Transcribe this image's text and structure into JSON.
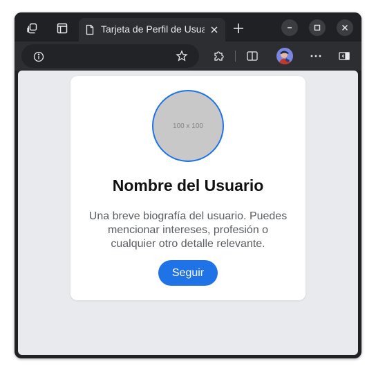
{
  "browser": {
    "tab": {
      "title": "Tarjeta de Perfil de Usuario"
    },
    "icons": {
      "workspaces": "workspaces-icon",
      "tab_actions": "tab-actions-icon",
      "page": "page-icon",
      "close": "close-icon",
      "new_tab": "plus-icon",
      "minimize": "minimize-icon",
      "maximize": "maximize-icon",
      "window_close": "close-icon",
      "site_info": "info-icon",
      "favorite": "star-icon",
      "extensions": "puzzle-icon",
      "split_screen": "split-screen-icon",
      "profile": "avatar",
      "more": "ellipsis-icon",
      "sidebar": "sidebar-icon"
    }
  },
  "profile_card": {
    "avatar_placeholder": "100 x 100",
    "name": "Nombre del Usuario",
    "bio": "Una breve biografía del usuario. Puedes mencionar intereses, profesión o cualquier otro detalle relevante.",
    "follow_label": "Seguir"
  },
  "colors": {
    "accent": "#1f73e6",
    "page_background": "#e9eaee",
    "card_background": "#ffffff",
    "browser_frame": "#202124"
  }
}
